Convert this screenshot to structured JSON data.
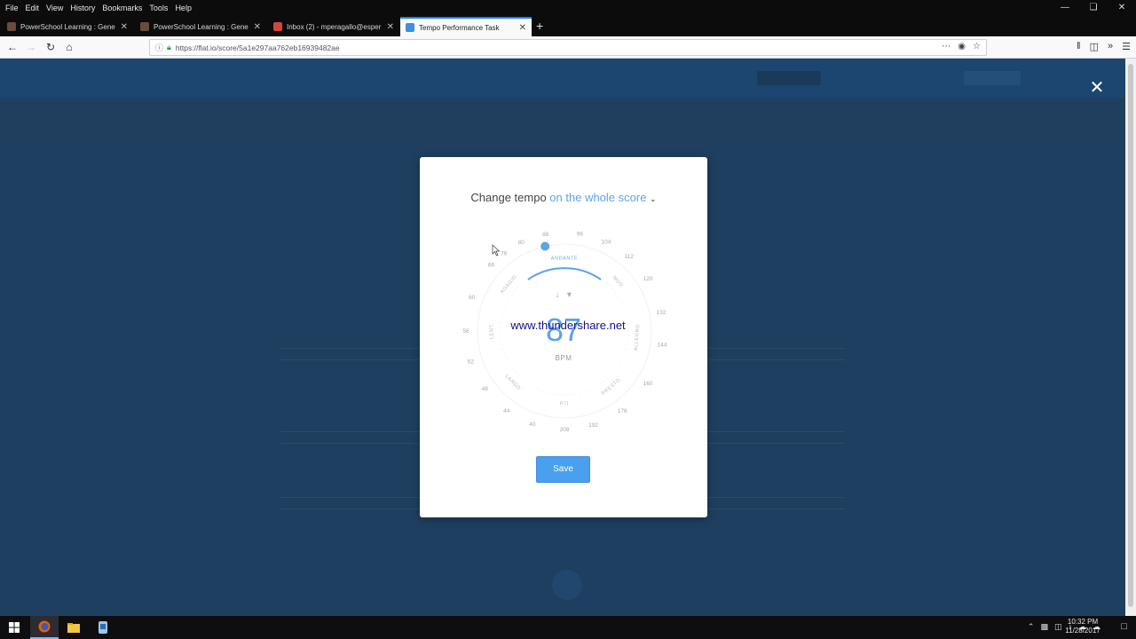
{
  "menubar": {
    "items": [
      "File",
      "Edit",
      "View",
      "History",
      "Bookmarks",
      "Tools",
      "Help"
    ]
  },
  "tabs": [
    {
      "label": "PowerSchool Learning : Gene",
      "favicon": "powerschool-favicon",
      "active": false
    },
    {
      "label": "PowerSchool Learning : Gene",
      "favicon": "powerschool-favicon",
      "active": false
    },
    {
      "label": "Inbox (2) - mperagallo@esper",
      "favicon": "gmail-favicon",
      "active": false
    },
    {
      "label": "Tempo Performance Task",
      "favicon": "flat-favicon",
      "active": true
    }
  ],
  "address_bar": {
    "url": "https://flat.io/score/5a1e297aa762eb16939482ae"
  },
  "modal": {
    "title_prefix": "Change tempo",
    "title_scope": "on the whole score",
    "bpm_value": "87",
    "bpm_unit": "BPM",
    "save_label": "Save",
    "current_tempo_bpm": 87,
    "dial_labels": [
      "76",
      "80",
      "88",
      "96",
      "104",
      "112",
      "120",
      "132",
      "144",
      "160",
      "176",
      "192",
      "208",
      "40",
      "44",
      "48",
      "52",
      "56",
      "60",
      "66"
    ],
    "tempo_terms": [
      "ANDANTE",
      "MOD.",
      "ALLEGRO",
      "PRESTO",
      "PTI",
      "LARGO",
      "LENT.",
      "ADAGIO"
    ],
    "active_term": "ANDANTE"
  },
  "watermark": "www.thundershare.net",
  "taskbar": {
    "time": "10:32 PM",
    "date": "11/28/2017"
  },
  "colors": {
    "accent": "#4a9fef",
    "scope_text": "#5fa1e8",
    "overlay": "#1f3f60"
  }
}
